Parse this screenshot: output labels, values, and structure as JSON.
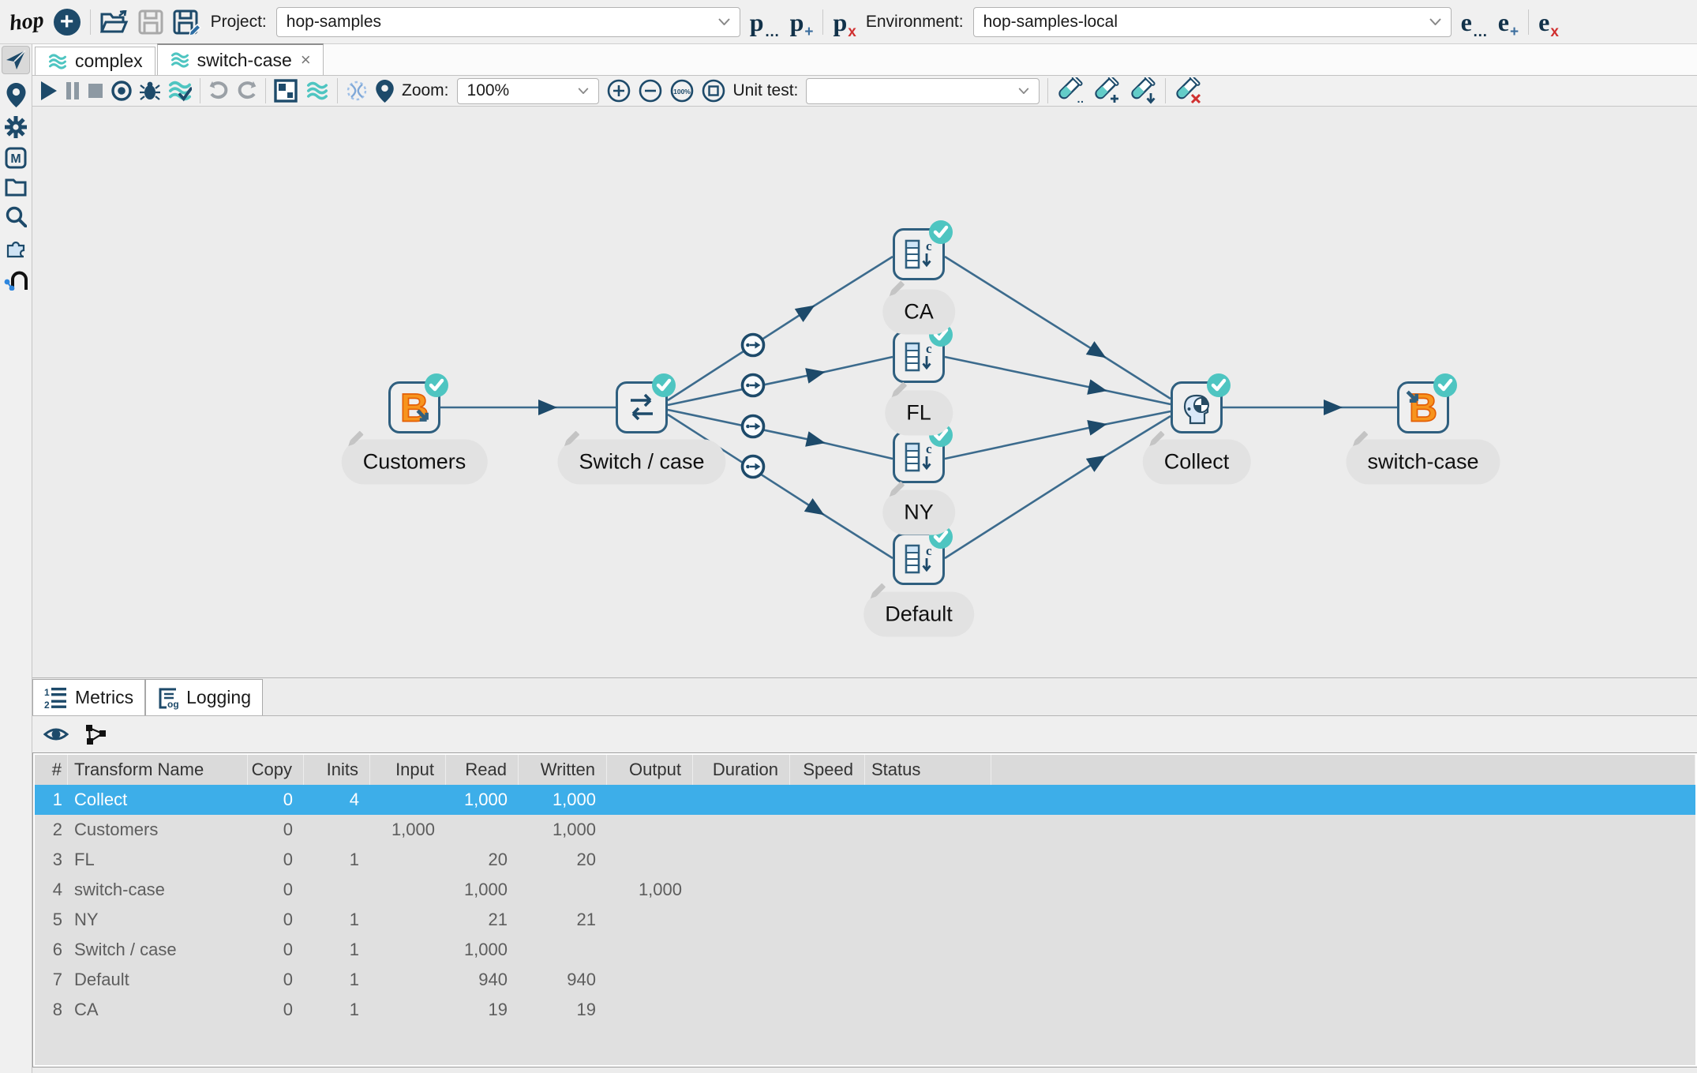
{
  "colors": {
    "accent_selection": "#3daee9",
    "navy": "#1d4a6a",
    "teal": "#4ec5c1",
    "beam_orange": "#f7941e"
  },
  "topbar": {
    "project_label": "Project:",
    "project_value": "hop-samples",
    "environment_label": "Environment:",
    "environment_value": "hop-samples-local"
  },
  "tabs": [
    {
      "label": "complex"
    },
    {
      "label": "switch-case",
      "close": "×"
    }
  ],
  "toolbar": {
    "zoom_label": "Zoom:",
    "zoom_value": "100%",
    "zoom_reset_label": "100%",
    "unit_test_label": "Unit test:",
    "unit_test_value": ""
  },
  "canvas": {
    "nodes": [
      {
        "label": "Customers"
      },
      {
        "label": "Switch / case"
      },
      {
        "label": "CA"
      },
      {
        "label": "FL"
      },
      {
        "label": "NY"
      },
      {
        "label": "Default"
      },
      {
        "label": "Collect"
      },
      {
        "label": "switch-case"
      }
    ]
  },
  "bottom": {
    "tabs": [
      {
        "label": "Metrics"
      },
      {
        "label": "Logging"
      }
    ]
  },
  "metrics": {
    "columns": [
      "#",
      "Transform Name",
      "Copy",
      "Inits",
      "Input",
      "Read",
      "Written",
      "Output",
      "Duration",
      "Speed",
      "Status"
    ],
    "selected_row": 0,
    "rows": [
      [
        "1",
        "Collect",
        "0",
        "4",
        "",
        "1,000",
        "1,000",
        "",
        "",
        "",
        ""
      ],
      [
        "2",
        "Customers",
        "0",
        "",
        "1,000",
        "",
        "1,000",
        "",
        "",
        "",
        ""
      ],
      [
        "3",
        "FL",
        "0",
        "1",
        "",
        "20",
        "20",
        "",
        "",
        "",
        ""
      ],
      [
        "4",
        "switch-case",
        "0",
        "",
        "",
        "1,000",
        "",
        "1,000",
        "",
        "",
        ""
      ],
      [
        "5",
        "NY",
        "0",
        "1",
        "",
        "21",
        "21",
        "",
        "",
        "",
        ""
      ],
      [
        "6",
        "Switch / case",
        "0",
        "1",
        "",
        "1,000",
        "",
        "",
        "",
        "",
        ""
      ],
      [
        "7",
        "Default",
        "0",
        "1",
        "",
        "940",
        "940",
        "",
        "",
        "",
        ""
      ],
      [
        "8",
        "CA",
        "0",
        "1",
        "",
        "19",
        "19",
        "",
        "",
        "",
        ""
      ]
    ]
  }
}
